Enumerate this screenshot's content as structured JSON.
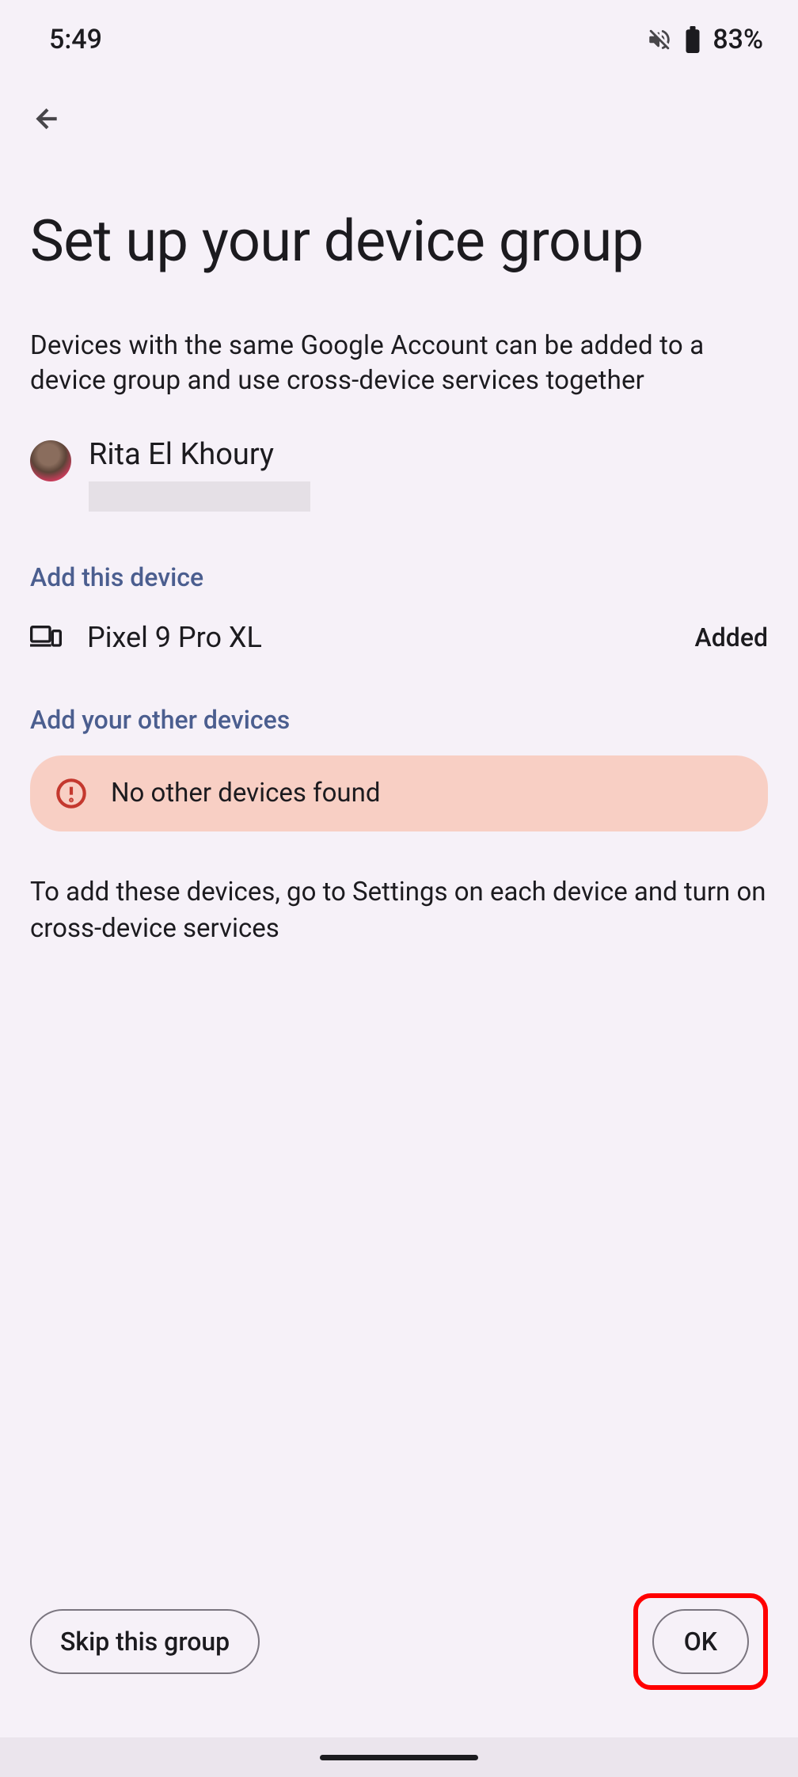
{
  "status": {
    "time": "5:49",
    "battery": "83%"
  },
  "page": {
    "title": "Set up your device group",
    "description": "Devices with the same Google Account can be added to a device group and use cross-device services together"
  },
  "account": {
    "name": "Rita El Khoury"
  },
  "sections": {
    "this_device_header": "Add this device",
    "other_devices_header": "Add your other devices"
  },
  "device": {
    "name": "Pixel 9 Pro XL",
    "status": "Added"
  },
  "warning": {
    "text": "No other devices found"
  },
  "help": {
    "text": "To add these devices, go to Settings on each device and turn on cross-device services"
  },
  "buttons": {
    "skip": "Skip this group",
    "ok": "OK"
  }
}
